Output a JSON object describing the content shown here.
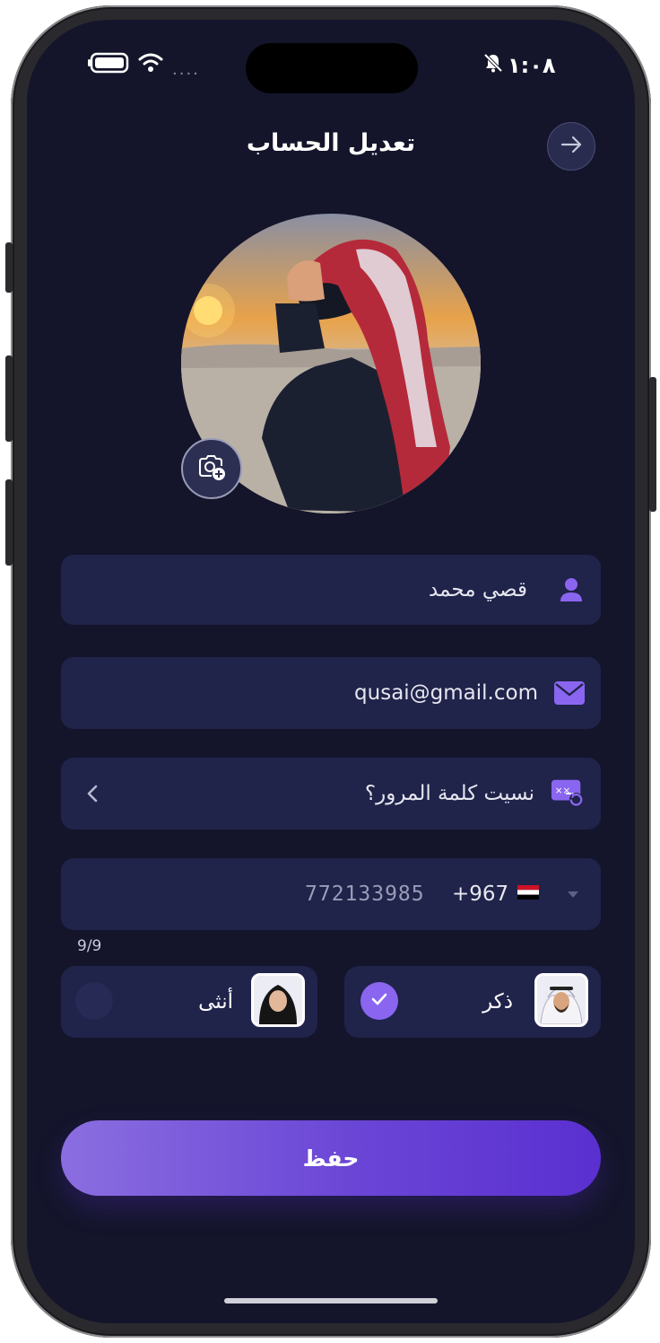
{
  "status_bar": {
    "time": "١:٠٨",
    "signal_dots": "....",
    "icons": [
      "battery-icon",
      "wifi-icon",
      "bell-muted-icon"
    ]
  },
  "header": {
    "title": "تعديل الحساب",
    "back_icon": "arrow-right-icon"
  },
  "profile": {
    "avatar_icon": "profile-photo",
    "camera_icon": "camera-add-icon"
  },
  "form": {
    "name": {
      "value": "قصي محمد",
      "icon": "user-icon"
    },
    "email": {
      "value": "qusai@gmail.com",
      "icon": "envelope-icon"
    },
    "password": {
      "label": "نسيت كلمة المرور؟",
      "icon": "password-reset-icon",
      "chevron_icon": "chevron-left-icon"
    },
    "phone": {
      "country_code": "+967",
      "number": "772133985",
      "flag_icon": "yemen-flag-icon",
      "dropdown_icon": "caret-down-icon",
      "counter": "9/9"
    }
  },
  "gender": {
    "male": {
      "label": "ذكر",
      "selected": true,
      "icon": "male-avatar"
    },
    "female": {
      "label": "أنثى",
      "selected": false,
      "icon": "female-avatar"
    }
  },
  "actions": {
    "save_label": "حفظ"
  },
  "colors": {
    "background": "#14152b",
    "field": "#20234a",
    "accent": "#8a66f0",
    "button_start": "#8b6ee0",
    "button_end": "#5a2fd0"
  }
}
